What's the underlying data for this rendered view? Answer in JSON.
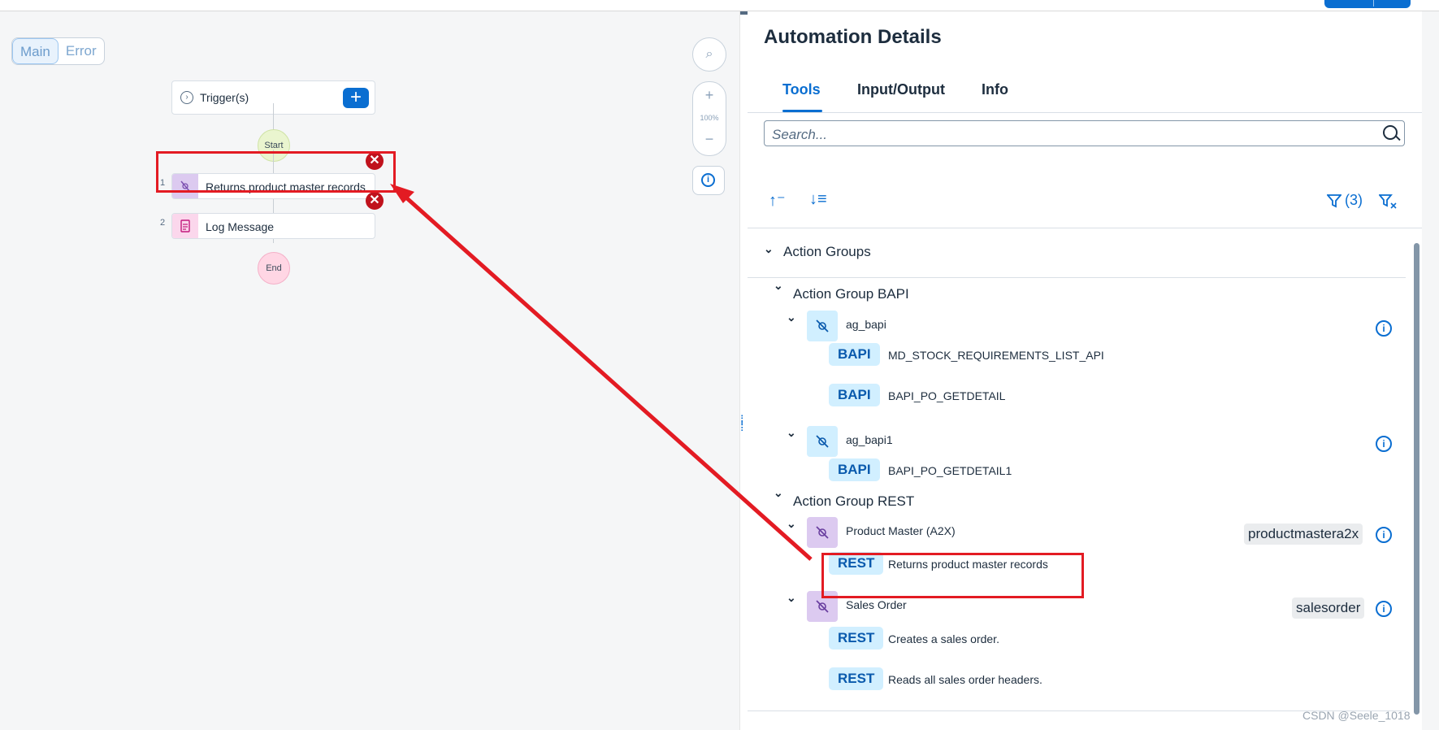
{
  "canvas": {
    "segments": [
      "Main",
      "Error"
    ],
    "trigger_label": "Trigger(s)",
    "start_label": "Start",
    "end_label": "End",
    "steps": [
      {
        "num": "1",
        "label": "Returns product master records"
      },
      {
        "num": "2",
        "label": "Log Message"
      }
    ],
    "zoom_label": "100%"
  },
  "panel": {
    "title": "Automation Details",
    "tabs": [
      "Tools",
      "Input/Output",
      "Info"
    ],
    "search_placeholder": "Search...",
    "filter_count": "(3)",
    "section_title": "Action Groups",
    "groups": [
      {
        "title": "Action Group BAPI",
        "action_groups": [
          {
            "name": "ag_bapi",
            "tag": "",
            "actions": [
              {
                "type": "BAPI",
                "name": "MD_STOCK_REQUIREMENTS_LIST_API"
              },
              {
                "type": "BAPI",
                "name": "BAPI_PO_GETDETAIL"
              }
            ]
          },
          {
            "name": "ag_bapi1",
            "tag": "",
            "actions": [
              {
                "type": "BAPI",
                "name": "BAPI_PO_GETDETAIL1"
              }
            ]
          }
        ]
      },
      {
        "title": "Action Group REST",
        "action_groups": [
          {
            "name": "Product Master (A2X)",
            "tag": "productmastera2x",
            "actions": [
              {
                "type": "REST",
                "name": "Returns product master records"
              }
            ]
          },
          {
            "name": "Sales Order",
            "tag": "salesorder",
            "actions": [
              {
                "type": "REST",
                "name": "Creates a sales order."
              },
              {
                "type": "REST",
                "name": "Reads all sales order headers."
              }
            ]
          }
        ]
      }
    ]
  },
  "watermark": "CSDN @Seele_1018",
  "colors": {
    "accent": "#0a6ed1",
    "annotation": "#e31b23",
    "error": "#c0121c"
  }
}
